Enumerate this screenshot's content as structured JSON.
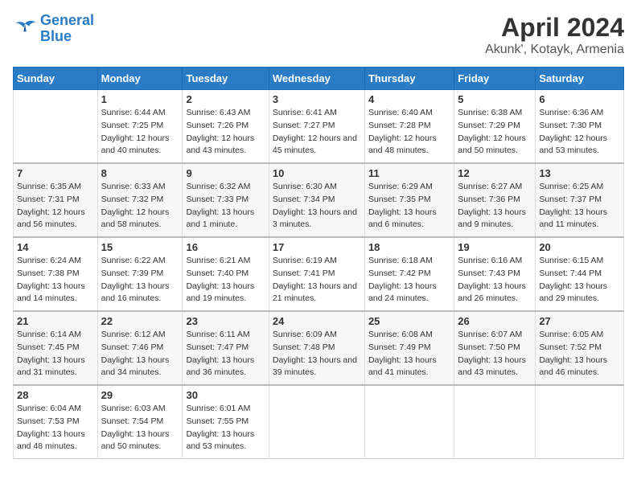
{
  "header": {
    "logo_line1": "General",
    "logo_line2": "Blue",
    "title": "April 2024",
    "subtitle": "Akunk', Kotayk, Armenia"
  },
  "days_of_week": [
    "Sunday",
    "Monday",
    "Tuesday",
    "Wednesday",
    "Thursday",
    "Friday",
    "Saturday"
  ],
  "weeks": [
    [
      {
        "num": "",
        "sunrise": "",
        "sunset": "",
        "daylight": ""
      },
      {
        "num": "1",
        "sunrise": "Sunrise: 6:44 AM",
        "sunset": "Sunset: 7:25 PM",
        "daylight": "Daylight: 12 hours and 40 minutes."
      },
      {
        "num": "2",
        "sunrise": "Sunrise: 6:43 AM",
        "sunset": "Sunset: 7:26 PM",
        "daylight": "Daylight: 12 hours and 43 minutes."
      },
      {
        "num": "3",
        "sunrise": "Sunrise: 6:41 AM",
        "sunset": "Sunset: 7:27 PM",
        "daylight": "Daylight: 12 hours and 45 minutes."
      },
      {
        "num": "4",
        "sunrise": "Sunrise: 6:40 AM",
        "sunset": "Sunset: 7:28 PM",
        "daylight": "Daylight: 12 hours and 48 minutes."
      },
      {
        "num": "5",
        "sunrise": "Sunrise: 6:38 AM",
        "sunset": "Sunset: 7:29 PM",
        "daylight": "Daylight: 12 hours and 50 minutes."
      },
      {
        "num": "6",
        "sunrise": "Sunrise: 6:36 AM",
        "sunset": "Sunset: 7:30 PM",
        "daylight": "Daylight: 12 hours and 53 minutes."
      }
    ],
    [
      {
        "num": "7",
        "sunrise": "Sunrise: 6:35 AM",
        "sunset": "Sunset: 7:31 PM",
        "daylight": "Daylight: 12 hours and 56 minutes."
      },
      {
        "num": "8",
        "sunrise": "Sunrise: 6:33 AM",
        "sunset": "Sunset: 7:32 PM",
        "daylight": "Daylight: 12 hours and 58 minutes."
      },
      {
        "num": "9",
        "sunrise": "Sunrise: 6:32 AM",
        "sunset": "Sunset: 7:33 PM",
        "daylight": "Daylight: 13 hours and 1 minute."
      },
      {
        "num": "10",
        "sunrise": "Sunrise: 6:30 AM",
        "sunset": "Sunset: 7:34 PM",
        "daylight": "Daylight: 13 hours and 3 minutes."
      },
      {
        "num": "11",
        "sunrise": "Sunrise: 6:29 AM",
        "sunset": "Sunset: 7:35 PM",
        "daylight": "Daylight: 13 hours and 6 minutes."
      },
      {
        "num": "12",
        "sunrise": "Sunrise: 6:27 AM",
        "sunset": "Sunset: 7:36 PM",
        "daylight": "Daylight: 13 hours and 9 minutes."
      },
      {
        "num": "13",
        "sunrise": "Sunrise: 6:25 AM",
        "sunset": "Sunset: 7:37 PM",
        "daylight": "Daylight: 13 hours and 11 minutes."
      }
    ],
    [
      {
        "num": "14",
        "sunrise": "Sunrise: 6:24 AM",
        "sunset": "Sunset: 7:38 PM",
        "daylight": "Daylight: 13 hours and 14 minutes."
      },
      {
        "num": "15",
        "sunrise": "Sunrise: 6:22 AM",
        "sunset": "Sunset: 7:39 PM",
        "daylight": "Daylight: 13 hours and 16 minutes."
      },
      {
        "num": "16",
        "sunrise": "Sunrise: 6:21 AM",
        "sunset": "Sunset: 7:40 PM",
        "daylight": "Daylight: 13 hours and 19 minutes."
      },
      {
        "num": "17",
        "sunrise": "Sunrise: 6:19 AM",
        "sunset": "Sunset: 7:41 PM",
        "daylight": "Daylight: 13 hours and 21 minutes."
      },
      {
        "num": "18",
        "sunrise": "Sunrise: 6:18 AM",
        "sunset": "Sunset: 7:42 PM",
        "daylight": "Daylight: 13 hours and 24 minutes."
      },
      {
        "num": "19",
        "sunrise": "Sunrise: 6:16 AM",
        "sunset": "Sunset: 7:43 PM",
        "daylight": "Daylight: 13 hours and 26 minutes."
      },
      {
        "num": "20",
        "sunrise": "Sunrise: 6:15 AM",
        "sunset": "Sunset: 7:44 PM",
        "daylight": "Daylight: 13 hours and 29 minutes."
      }
    ],
    [
      {
        "num": "21",
        "sunrise": "Sunrise: 6:14 AM",
        "sunset": "Sunset: 7:45 PM",
        "daylight": "Daylight: 13 hours and 31 minutes."
      },
      {
        "num": "22",
        "sunrise": "Sunrise: 6:12 AM",
        "sunset": "Sunset: 7:46 PM",
        "daylight": "Daylight: 13 hours and 34 minutes."
      },
      {
        "num": "23",
        "sunrise": "Sunrise: 6:11 AM",
        "sunset": "Sunset: 7:47 PM",
        "daylight": "Daylight: 13 hours and 36 minutes."
      },
      {
        "num": "24",
        "sunrise": "Sunrise: 6:09 AM",
        "sunset": "Sunset: 7:48 PM",
        "daylight": "Daylight: 13 hours and 39 minutes."
      },
      {
        "num": "25",
        "sunrise": "Sunrise: 6:08 AM",
        "sunset": "Sunset: 7:49 PM",
        "daylight": "Daylight: 13 hours and 41 minutes."
      },
      {
        "num": "26",
        "sunrise": "Sunrise: 6:07 AM",
        "sunset": "Sunset: 7:50 PM",
        "daylight": "Daylight: 13 hours and 43 minutes."
      },
      {
        "num": "27",
        "sunrise": "Sunrise: 6:05 AM",
        "sunset": "Sunset: 7:52 PM",
        "daylight": "Daylight: 13 hours and 46 minutes."
      }
    ],
    [
      {
        "num": "28",
        "sunrise": "Sunrise: 6:04 AM",
        "sunset": "Sunset: 7:53 PM",
        "daylight": "Daylight: 13 hours and 48 minutes."
      },
      {
        "num": "29",
        "sunrise": "Sunrise: 6:03 AM",
        "sunset": "Sunset: 7:54 PM",
        "daylight": "Daylight: 13 hours and 50 minutes."
      },
      {
        "num": "30",
        "sunrise": "Sunrise: 6:01 AM",
        "sunset": "Sunset: 7:55 PM",
        "daylight": "Daylight: 13 hours and 53 minutes."
      },
      {
        "num": "",
        "sunrise": "",
        "sunset": "",
        "daylight": ""
      },
      {
        "num": "",
        "sunrise": "",
        "sunset": "",
        "daylight": ""
      },
      {
        "num": "",
        "sunrise": "",
        "sunset": "",
        "daylight": ""
      },
      {
        "num": "",
        "sunrise": "",
        "sunset": "",
        "daylight": ""
      }
    ]
  ]
}
